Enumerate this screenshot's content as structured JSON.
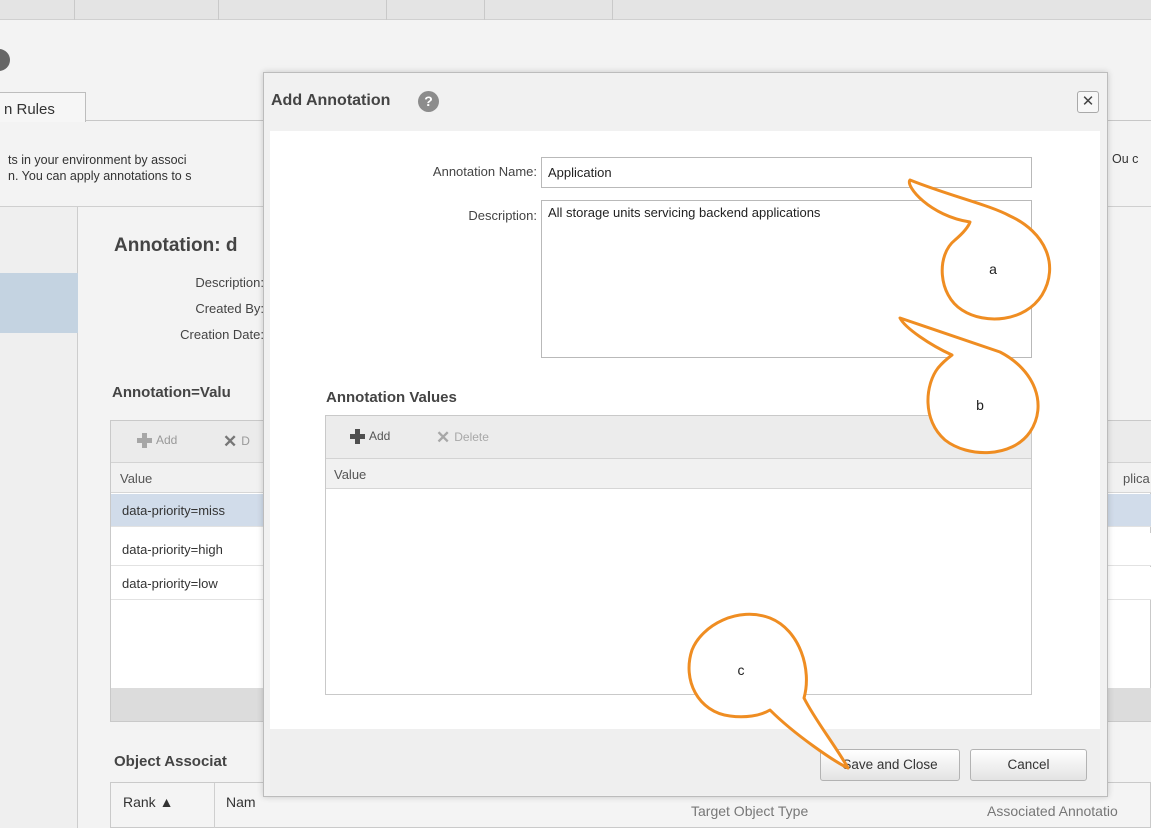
{
  "background": {
    "tab_label": "n Rules",
    "intro_line1": "ts in your environment by associ",
    "intro_line2": "n. You can apply annotations to s",
    "intro_right": "Ou c",
    "annotation_title": "Annotation: d",
    "meta": {
      "description_label": "Description:",
      "created_by_label": "Created By:",
      "creation_date_label": "Creation Date:"
    },
    "values_section_title": "Annotation=Valu",
    "toolbar": {
      "add_label": "Add",
      "delete_label": "D"
    },
    "grid": {
      "value_header": "Value",
      "right_header": "plica",
      "rows": [
        "data-priority=miss",
        "data-priority=high",
        "data-priority=low"
      ]
    },
    "object_section_title": "Object Associat",
    "object_headers": {
      "rank": "Rank ▲",
      "name": "Nam",
      "target": "Target Object Type",
      "assoc": "Associated Annotatio"
    }
  },
  "dialog": {
    "title": "Add Annotation",
    "help_glyph": "?",
    "close_glyph": "✕",
    "annotation_name_label": "Annotation Name:",
    "annotation_name_value": "Application",
    "description_label": "Description:",
    "description_value": "All storage units servicing backend applications",
    "values_title": "Annotation Values",
    "add_label": "Add",
    "delete_label": "Delete",
    "value_header": "Value",
    "save_button": "Save and Close",
    "cancel_button": "Cancel"
  },
  "callouts": {
    "a": "a",
    "b": "b",
    "c": "c",
    "stroke_color": "#ef8d22"
  }
}
